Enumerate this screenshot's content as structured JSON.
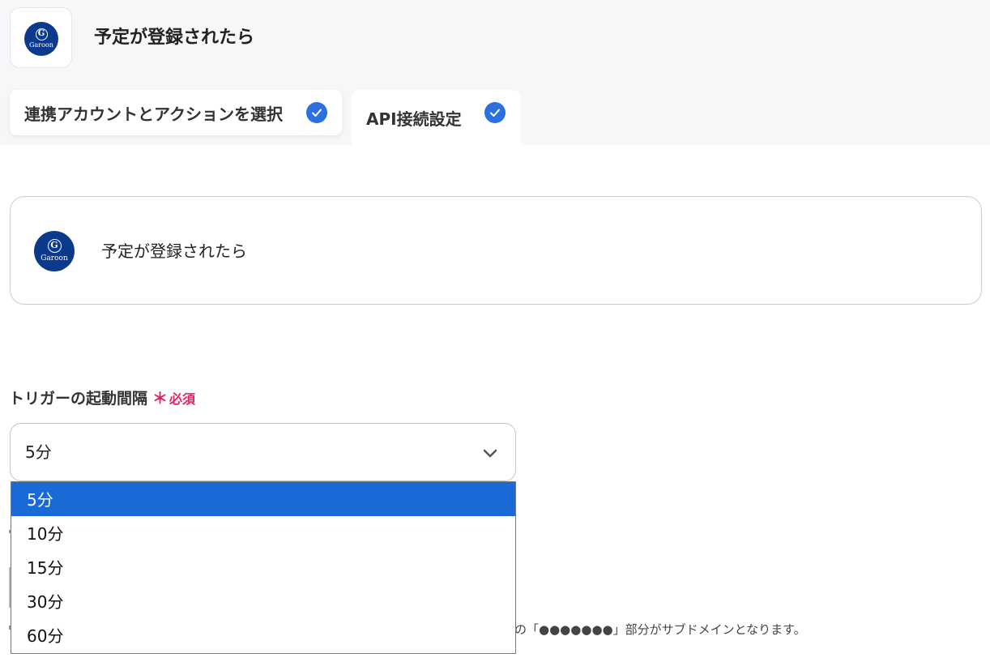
{
  "header": {
    "app_logo": {
      "icon": "garoon-logo",
      "letter": "G",
      "wordmark": "Garoon"
    },
    "title": "予定が登録されたら",
    "tabs": [
      {
        "label": "連携アカウントとアクションを選択",
        "completed": true,
        "icon": "check-circle-icon"
      },
      {
        "label": "API接続設定",
        "completed": true,
        "icon": "check-circle-icon",
        "active": true
      }
    ]
  },
  "trigger_card": {
    "logo": {
      "icon": "garoon-logo",
      "letter": "G",
      "wordmark": "Garoon"
    },
    "title": "予定が登録されたら"
  },
  "interval_field": {
    "label": "トリガーの起動間隔",
    "required_star": "＊",
    "required_text": "必須",
    "selected_value": "5分",
    "options": [
      "5分",
      "10分",
      "15分",
      "30分",
      "60分"
    ],
    "selected_index": 0
  },
  "help_text": "の「●●●●●●●」部分がサブドメインとなります。",
  "colors": {
    "accent": "#2b6fe0",
    "selected_option": "#1a6ad6",
    "required": "#e0245e",
    "logo_bg": "#0b3a8c",
    "header_bg": "#f6f7f9"
  }
}
